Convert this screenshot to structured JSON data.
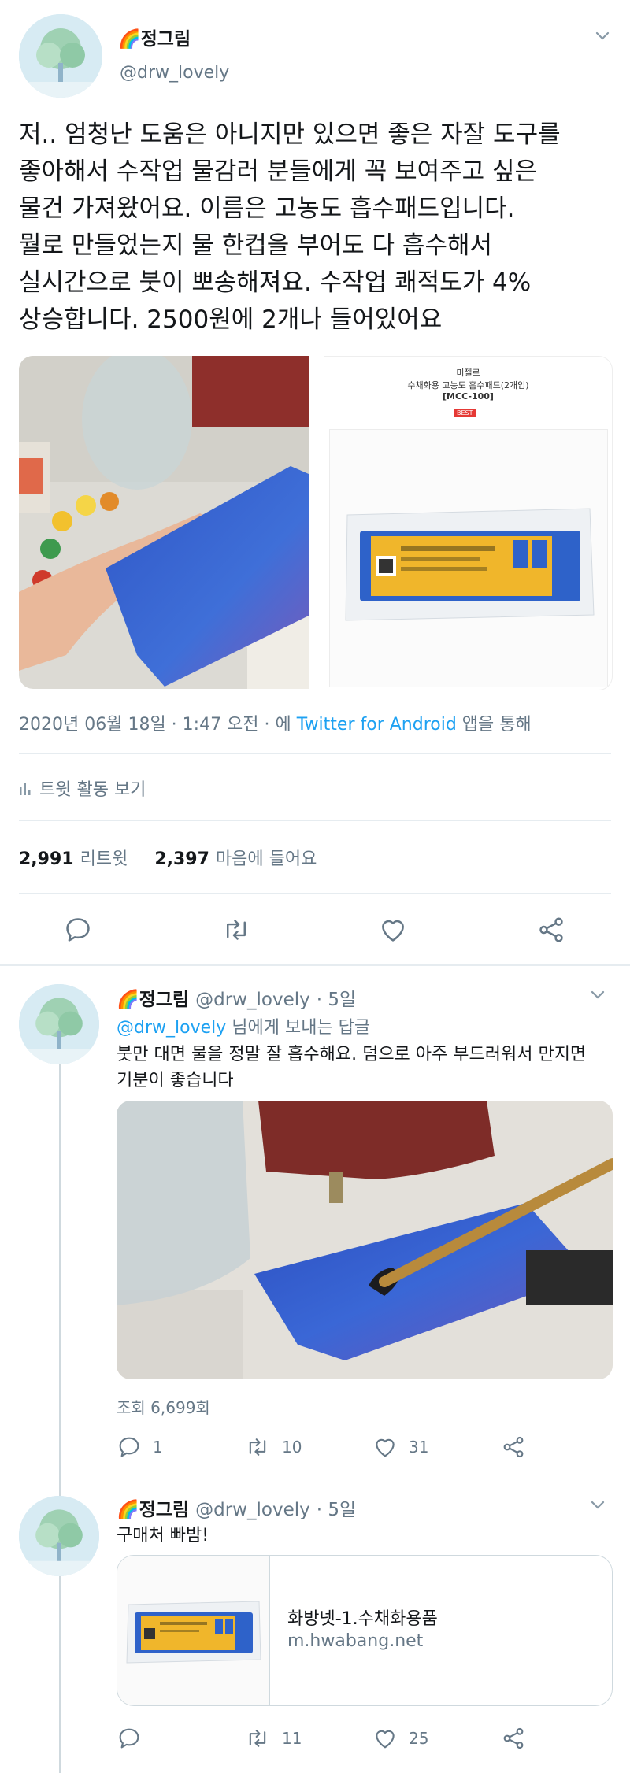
{
  "main": {
    "display_name": "🌈정그림",
    "handle": "@drw_lovely",
    "text_lines": [
      "저.. 엄청난 도움은 아니지만 있으면 좋은 자잘 도구를",
      "좋아해서 수작업 물감러 분들에게 꼭 보여주고 싶은",
      "물건 가져왔어요. 이름은 고농도 흡수패드입니다.",
      "뭘로 만들었는지 물 한컵을 부어도 다 흡수해서",
      "실시간으로 붓이 뽀송해져요. 수작업 쾌적도가 4%",
      "상승합니다. 2500원에 2개나 들어있어요"
    ],
    "product_image": {
      "brand": "미젤로",
      "title": "수채화용 고농도 흡수패드(2개입)",
      "code": "[MCC-100]",
      "badge": "BEST"
    },
    "meta_prefix": "2020년 06월 18일 · 1:47 오전 · 에 ",
    "meta_source": "Twitter for Android",
    "meta_suffix": " 앱을 통해",
    "activity_label": "트윗 활동 보기",
    "retweets_count": "2,991",
    "retweets_label": "리트윗",
    "likes_count": "2,397",
    "likes_label": "마음에 들어요"
  },
  "reply1": {
    "display_name": "🌈정그림",
    "handle": "@drw_lovely",
    "time": "· 5일",
    "reply_to_handle": "@drw_lovely",
    "reply_to_suffix": " 님에게 보내는 답글",
    "text_lines": [
      "붓만 대면 물을 정말 잘 흡수해요. 덤으로 아주 부드러워서 만지면",
      "기분이 좋습니다"
    ],
    "views": "조회 6,699회",
    "replies": "1",
    "retweets": "10",
    "likes": "31"
  },
  "reply2": {
    "display_name": "🌈정그림",
    "handle": "@drw_lovely",
    "time": "· 5일",
    "text": "구매처 빠밤!",
    "card_title": "화방넷-1.수채화용품",
    "card_domain": "m.hwabang.net",
    "replies": "",
    "retweets": "11",
    "likes": "25"
  },
  "colors": {
    "link": "#1da1f2",
    "muted": "#657786",
    "divider": "#e6ecf0"
  },
  "icons": [
    "chevron-down-icon",
    "reply-icon",
    "retweet-icon",
    "like-icon",
    "share-icon",
    "bar-chart-icon"
  ]
}
